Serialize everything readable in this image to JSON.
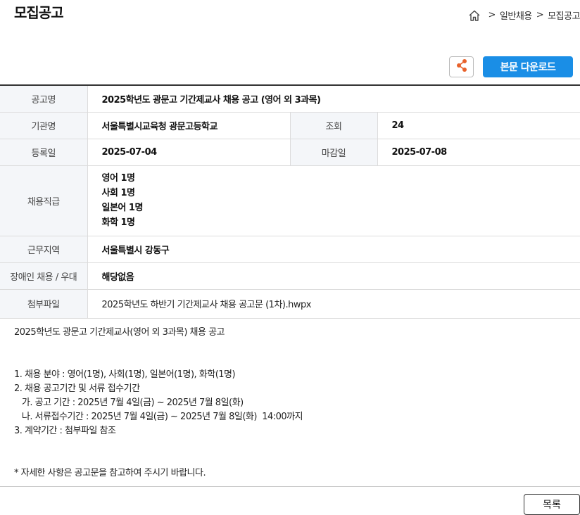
{
  "page": {
    "title": "모집공고"
  },
  "breadcrumb": {
    "items": [
      "일반채용",
      "모집공고"
    ],
    "separator": ">"
  },
  "toolbar": {
    "share_icon": "share-icon",
    "download_label": "본문 다운로드"
  },
  "info": {
    "title_label": "공고명",
    "title_value": "2025학년도 광문고 기간제교사 채용 공고 (영어 외 3과목)",
    "org_label": "기관명",
    "org_value": "서울특별시교육청 광문고등학교",
    "views_label": "조회",
    "views_value": "24",
    "reg_label": "등록일",
    "reg_value": "2025-07-04",
    "deadline_label": "마감일",
    "deadline_value": "2025-07-08",
    "positions_label": "채용직급",
    "positions": [
      "영어 1명",
      "사회 1명",
      "일본어 1명",
      "화학 1명"
    ],
    "region_label": "근무지역",
    "region_value": "서울특별시 강동구",
    "disability_label": "장애인 채용 / 우대",
    "disability_value": "해당없음",
    "attach_label": "첨부파일",
    "attach_value": "2025학년도 하반기 기간제교사 채용 공고문 (1차).hwpx"
  },
  "body": {
    "heading": "2025학년도 광문고 기간제교사(영어 외 3과목) 채용 공고",
    "line1": "1. 채용 분야 : 영어(1명), 사회(1명), 일본어(1명), 화학(1명)",
    "line2": "2. 채용 공고기간 및 서류 접수기간",
    "line3": "   가. 공고 기간 : 2025년 7월 4일(금) ~ 2025년 7월 8일(화)",
    "line4": "   나. 서류접수기간 : 2025년 7월 4일(금) ~ 2025년 7월 8일(화)  14:00까지",
    "line5": "3. 계약기간 : 첨부파일 참조",
    "note": "* 자세한 사항은 공고문을 참고하여 주시기 바랍니다."
  },
  "footer": {
    "list_label": "목록"
  },
  "colors": {
    "accent": "#1a8ee6",
    "header_bg": "#f4f6f9",
    "share_icon": "#e8622c"
  }
}
